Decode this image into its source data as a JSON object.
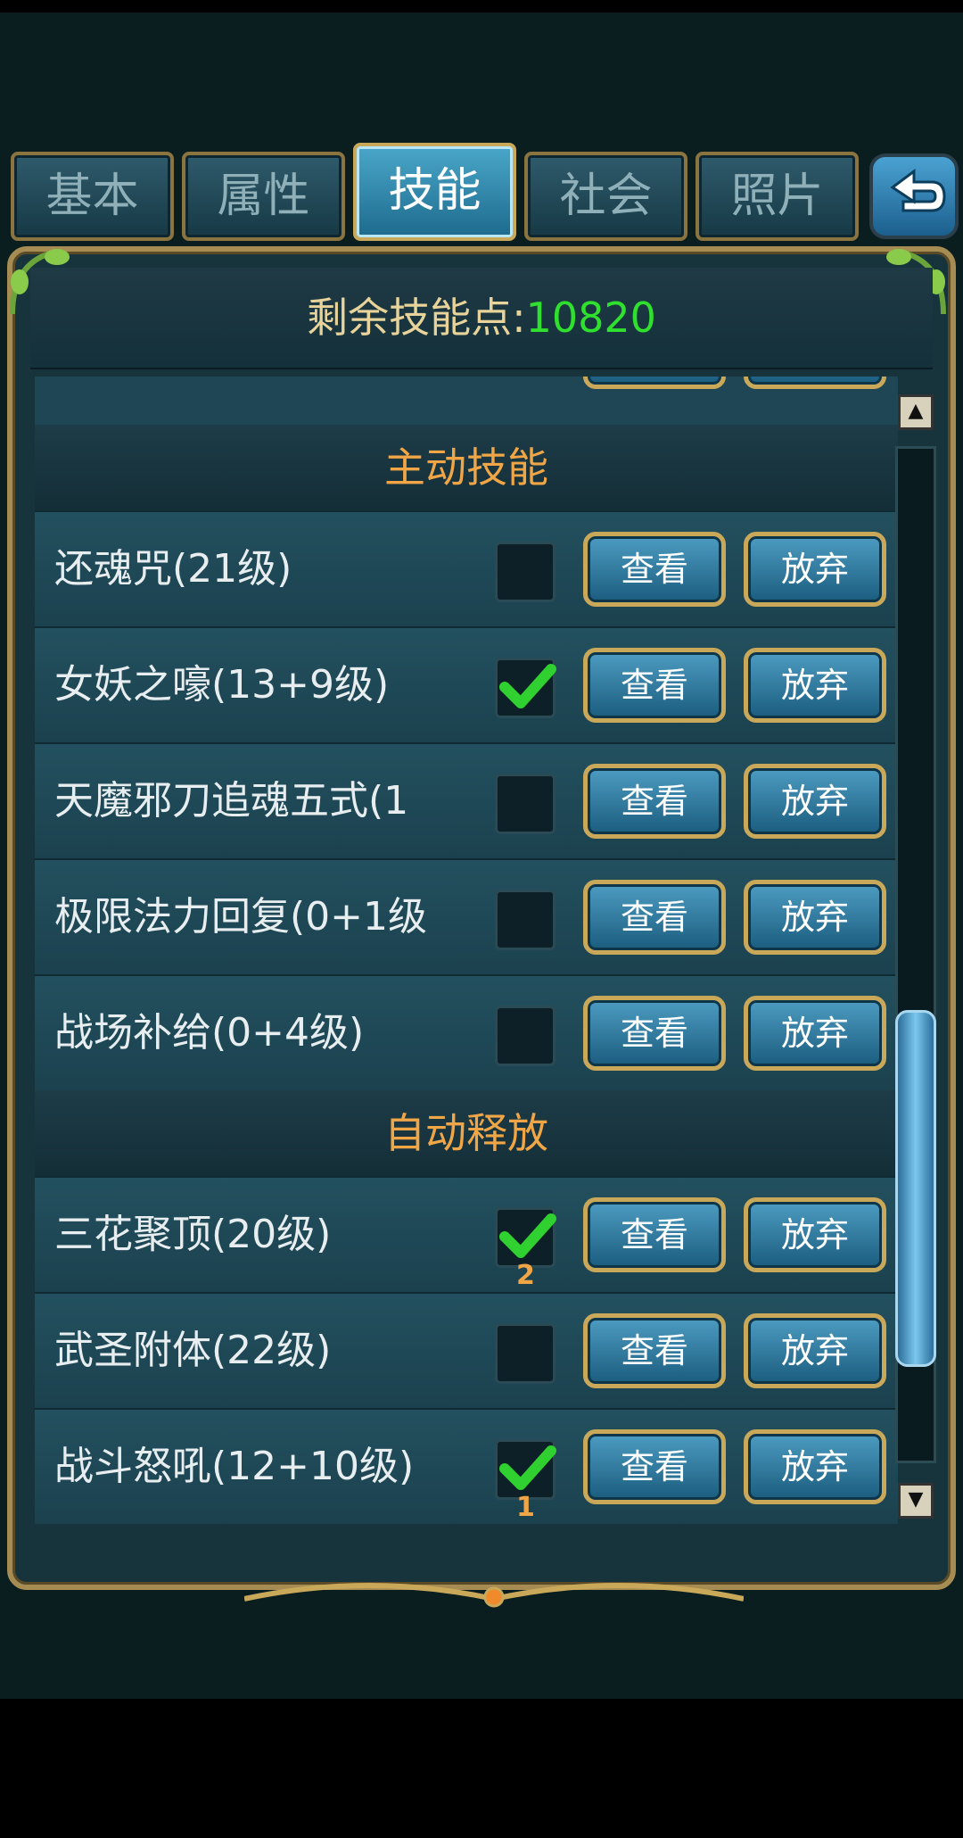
{
  "tabs": [
    {
      "label": "基本",
      "active": false
    },
    {
      "label": "属性",
      "active": false
    },
    {
      "label": "技能",
      "active": true
    },
    {
      "label": "社会",
      "active": false
    },
    {
      "label": "照片",
      "active": false
    }
  ],
  "header": {
    "label": "剩余技能点:",
    "value": "10820"
  },
  "sections": {
    "active": "主动技能",
    "auto": "自动释放"
  },
  "buttons": {
    "view": "查看",
    "drop": "放弃"
  },
  "skills": [
    {
      "name": "还魂咒(21级)",
      "checked": false,
      "badge": ""
    },
    {
      "name": "女妖之嚎(13+9级)",
      "checked": true,
      "badge": ""
    },
    {
      "name": "天魔邪刀追魂五式(1",
      "checked": false,
      "badge": ""
    },
    {
      "name": "极限法力回复(0+1级",
      "checked": false,
      "badge": ""
    },
    {
      "name": "战场补给(0+4级)",
      "checked": false,
      "badge": ""
    },
    {
      "name": "三花聚顶(20级)",
      "checked": true,
      "badge": "2"
    },
    {
      "name": "武圣附体(22级)",
      "checked": false,
      "badge": ""
    },
    {
      "name": "战斗怒吼(12+10级)",
      "checked": true,
      "badge": "1"
    }
  ],
  "scrollbar": {
    "position_fraction": 0.78
  }
}
